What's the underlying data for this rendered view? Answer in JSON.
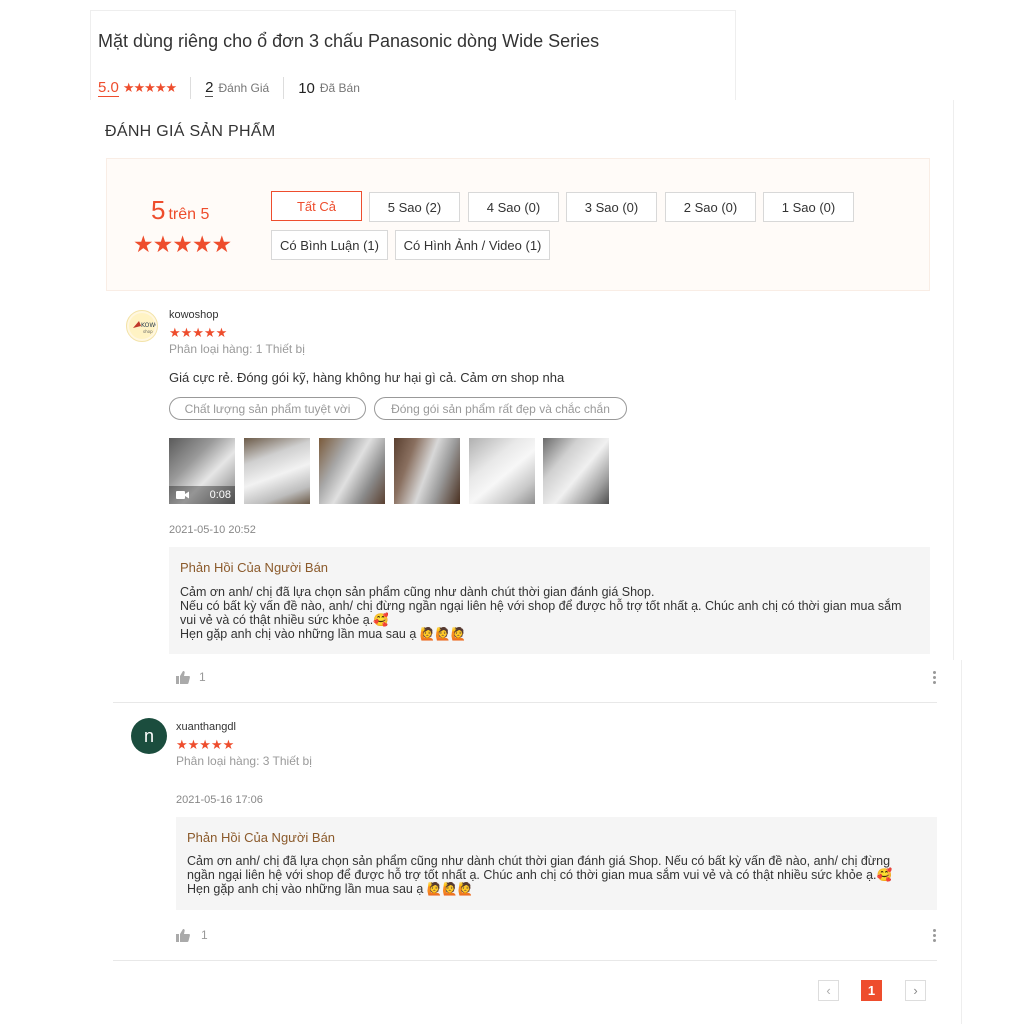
{
  "product": {
    "title": "Mặt dùng riêng cho ổ đơn 3 chấu Panasonic dòng Wide Series",
    "rating": "5.0",
    "stars": "★★★★★",
    "review_count": "2",
    "review_label": "Đánh Giá",
    "sold_count": "10",
    "sold_label": "Đã Bán"
  },
  "ratings_section": {
    "title": "ĐÁNH GIÁ SẢN PHẨM",
    "score": "5",
    "score_suffix": "trên 5",
    "stars": "★★★★★",
    "filters": [
      "Tất Cả",
      "5 Sao (2)",
      "4 Sao (0)",
      "3 Sao (0)",
      "2 Sao (0)",
      "1 Sao (0)",
      "Có Bình Luận (1)",
      "Có Hình Ảnh / Video (1)"
    ]
  },
  "reviews": [
    {
      "username": "kowoshop",
      "stars": "★★★★★",
      "variation": "Phân loại hàng: 1 Thiết bị",
      "comment": "Giá cực rẻ. Đóng gói kỹ, hàng không hư hại gì cả. Cảm ơn shop nha",
      "tags": [
        "Chất lượng sản phẩm tuyệt vời",
        "Đóng gói sản phẩm rất đẹp và chắc chắn"
      ],
      "video_duration": "0:08",
      "datetime": "2021-05-10 20:52",
      "reply_title": "Phản Hồi Của Người Bán",
      "reply_lines": [
        "Cảm ơn anh/ chị đã lựa chọn sản phẩm cũng như dành chút thời gian đánh giá Shop.",
        "Nếu có bất kỳ vấn đề nào, anh/ chị đừng ngần ngại liên hệ với shop để được hỗ trợ tốt nhất ạ. Chúc anh chị có thời gian mua sắm",
        "vui vẻ và có thật nhiều sức khỏe ạ.🥰",
        "Hẹn gặp anh chị vào những lần mua sau ạ 🙋🙋🙋"
      ],
      "likes": "1"
    },
    {
      "username": "xuanthangdl",
      "avatar_letter": "n",
      "stars": "★★★★★",
      "variation": "Phân loại hàng: 3 Thiết bị",
      "datetime": "2021-05-16 17:06",
      "reply_title": "Phản Hồi Của Người Bán",
      "reply_lines": [
        "Cảm ơn anh/ chị đã lựa chọn sản phẩm cũng như dành chút thời gian đánh giá Shop. Nếu có bất kỳ vấn đề nào, anh/ chị đừng",
        "ngần ngại liên hệ với shop để được hỗ trợ tốt nhất ạ. Chúc anh chị có thời gian mua sắm vui vẻ và có thật nhiều sức khỏe ạ.🥰",
        "Hẹn gặp anh chị vào những lần mua sau ạ 🙋🙋🙋"
      ],
      "likes": "1"
    }
  ],
  "pagination": {
    "current": "1",
    "prev": "‹",
    "next": "›"
  },
  "colors": {
    "accent": "#ee4d2d",
    "reply_title": "#8b5a2b",
    "avatar_green": "#1b4d3e"
  }
}
